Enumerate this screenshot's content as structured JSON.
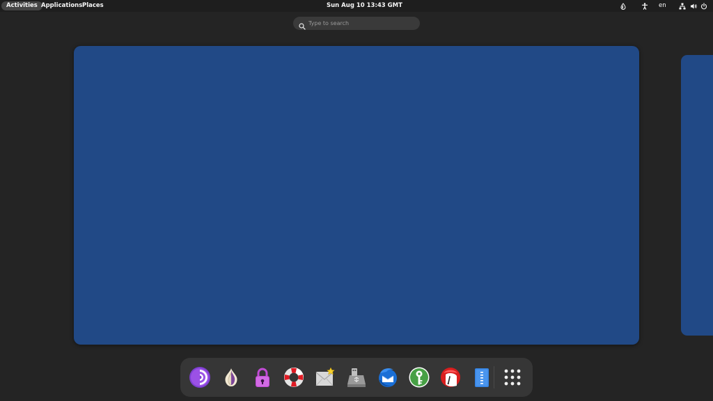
{
  "topbar": {
    "activities": "Activities",
    "applications": "Applications",
    "places": "Places",
    "clock": "Sun Aug 10  13:43 GMT",
    "language": "en",
    "tray_icons": [
      "night-light-icon",
      "accessibility-icon",
      "network-icon",
      "volume-icon",
      "power-icon"
    ]
  },
  "search": {
    "placeholder": "Type to search"
  },
  "workspace": {
    "color": "#214986"
  },
  "dash": {
    "apps": [
      "tor-browser-icon",
      "onion-circuits-icon",
      "unlock-veracrypt-icon",
      "help-lifebuoy-icon",
      "welcome-screen-icon",
      "usb-installer-icon",
      "thunderbird-icon",
      "keepassxc-icon",
      "electrum-icon",
      "text-editor-icon",
      "show-applications-icon"
    ]
  }
}
